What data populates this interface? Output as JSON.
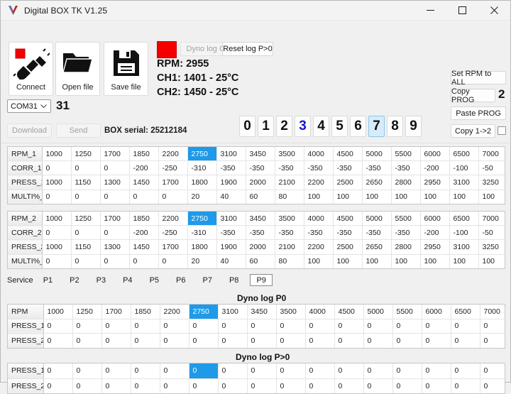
{
  "window": {
    "title": "Digital BOX TK V1.25",
    "logo_icon": "v-logo-icon",
    "minimize_icon": "minimize-icon",
    "maximize_icon": "maximize-icon",
    "close_icon": "close-icon"
  },
  "toolbar": {
    "connect_label": "Connect",
    "connect_icon": "plug-connect-icon",
    "open_label": "Open file",
    "open_icon": "folder-icon",
    "save_label": "Save file",
    "save_icon": "floppy-disk-icon",
    "dyno_log_label": "Dyno log ON",
    "reset_log_label": "Reset log P>0",
    "status_square_color": "#f40000"
  },
  "readouts": {
    "rpm": "RPM: 2955",
    "ch1": "CH1: 1401 - 25°C",
    "ch2": "CH2: 1450 - 25°C"
  },
  "connection": {
    "port_value": "COM31",
    "port_number": "31",
    "dropdown_icon": "chevron-down-icon",
    "download_label": "Download",
    "send_label": "Send",
    "box_serial": "BOX serial: 25212184"
  },
  "prog": {
    "digits": [
      "0",
      "1",
      "2",
      "3",
      "4",
      "5",
      "6",
      "7",
      "8",
      "9"
    ],
    "blue_index": 3,
    "selected_index": 7
  },
  "side_actions": {
    "set_rpm_label": "Set RPM to ALL",
    "copy_prog_label": "Copy PROG",
    "copy_prog_value": "2",
    "paste_prog_label": "Paste PROG",
    "copy_1to2_label": "Copy 1->2",
    "copy_1to2_checked": false
  },
  "table1": {
    "rows": [
      {
        "label": "RPM_1",
        "values": [
          "1000",
          "1250",
          "1700",
          "1850",
          "2200",
          "2750",
          "3100",
          "3450",
          "3500",
          "4000",
          "4500",
          "5000",
          "5500",
          "6000",
          "6500",
          "7000"
        ],
        "selected": 5
      },
      {
        "label": "CORR_1",
        "values": [
          "0",
          "0",
          "0",
          "-200",
          "-250",
          "-310",
          "-350",
          "-350",
          "-350",
          "-350",
          "-350",
          "-350",
          "-350",
          "-200",
          "-100",
          "-50"
        ],
        "selected": -1
      },
      {
        "label": "PRESS_1",
        "values": [
          "1000",
          "1150",
          "1300",
          "1450",
          "1700",
          "1800",
          "1900",
          "2000",
          "2100",
          "2200",
          "2500",
          "2650",
          "2800",
          "2950",
          "3100",
          "3250"
        ],
        "selected": -1
      },
      {
        "label": "MULTI%_",
        "values": [
          "0",
          "0",
          "0",
          "0",
          "0",
          "20",
          "40",
          "60",
          "80",
          "100",
          "100",
          "100",
          "100",
          "100",
          "100",
          "100"
        ],
        "selected": -1
      }
    ]
  },
  "table2": {
    "rows": [
      {
        "label": "RPM_2",
        "values": [
          "1000",
          "1250",
          "1700",
          "1850",
          "2200",
          "2750",
          "3100",
          "3450",
          "3500",
          "4000",
          "4500",
          "5000",
          "5500",
          "6000",
          "6500",
          "7000"
        ],
        "selected": 5
      },
      {
        "label": "CORR_2",
        "values": [
          "0",
          "0",
          "0",
          "-200",
          "-250",
          "-310",
          "-350",
          "-350",
          "-350",
          "-350",
          "-350",
          "-350",
          "-350",
          "-200",
          "-100",
          "-50"
        ],
        "selected": -1
      },
      {
        "label": "PRESS_2",
        "values": [
          "1000",
          "1150",
          "1300",
          "1450",
          "1700",
          "1800",
          "1900",
          "2000",
          "2100",
          "2200",
          "2500",
          "2650",
          "2800",
          "2950",
          "3100",
          "3250"
        ],
        "selected": -1
      },
      {
        "label": "MULTI%_",
        "values": [
          "0",
          "0",
          "0",
          "0",
          "0",
          "20",
          "40",
          "60",
          "80",
          "100",
          "100",
          "100",
          "100",
          "100",
          "100",
          "100"
        ],
        "selected": -1
      }
    ]
  },
  "tabs": {
    "service_label": "Service",
    "items": [
      "P1",
      "P2",
      "P3",
      "P4",
      "P5",
      "P6",
      "P7",
      "P8",
      "P9"
    ],
    "active_index": 8
  },
  "dyno_p0": {
    "title": "Dyno log  P0",
    "rows": [
      {
        "label": "RPM",
        "values": [
          "1000",
          "1250",
          "1700",
          "1850",
          "2200",
          "2750",
          "3100",
          "3450",
          "3500",
          "4000",
          "4500",
          "5000",
          "5500",
          "6000",
          "6500",
          "7000"
        ],
        "selected": 5
      },
      {
        "label": "PRESS_1",
        "values": [
          "0",
          "0",
          "0",
          "0",
          "0",
          "0",
          "0",
          "0",
          "0",
          "0",
          "0",
          "0",
          "0",
          "0",
          "0",
          "0"
        ],
        "selected": -1
      },
      {
        "label": "PRESS_2",
        "values": [
          "0",
          "0",
          "0",
          "0",
          "0",
          "0",
          "0",
          "0",
          "0",
          "0",
          "0",
          "0",
          "0",
          "0",
          "0",
          "0"
        ],
        "selected": -1
      }
    ]
  },
  "dyno_pgt0": {
    "title": "Dyno log  P>0",
    "rows": [
      {
        "label": "PRESS_1",
        "values": [
          "0",
          "0",
          "0",
          "0",
          "0",
          "0",
          "0",
          "0",
          "0",
          "0",
          "0",
          "0",
          "0",
          "0",
          "0",
          "0"
        ],
        "selected": 5
      },
      {
        "label": "PRESS_2",
        "values": [
          "0",
          "0",
          "0",
          "0",
          "0",
          "0",
          "0",
          "0",
          "0",
          "0",
          "0",
          "0",
          "0",
          "0",
          "0",
          "0"
        ],
        "selected": -1
      }
    ]
  }
}
